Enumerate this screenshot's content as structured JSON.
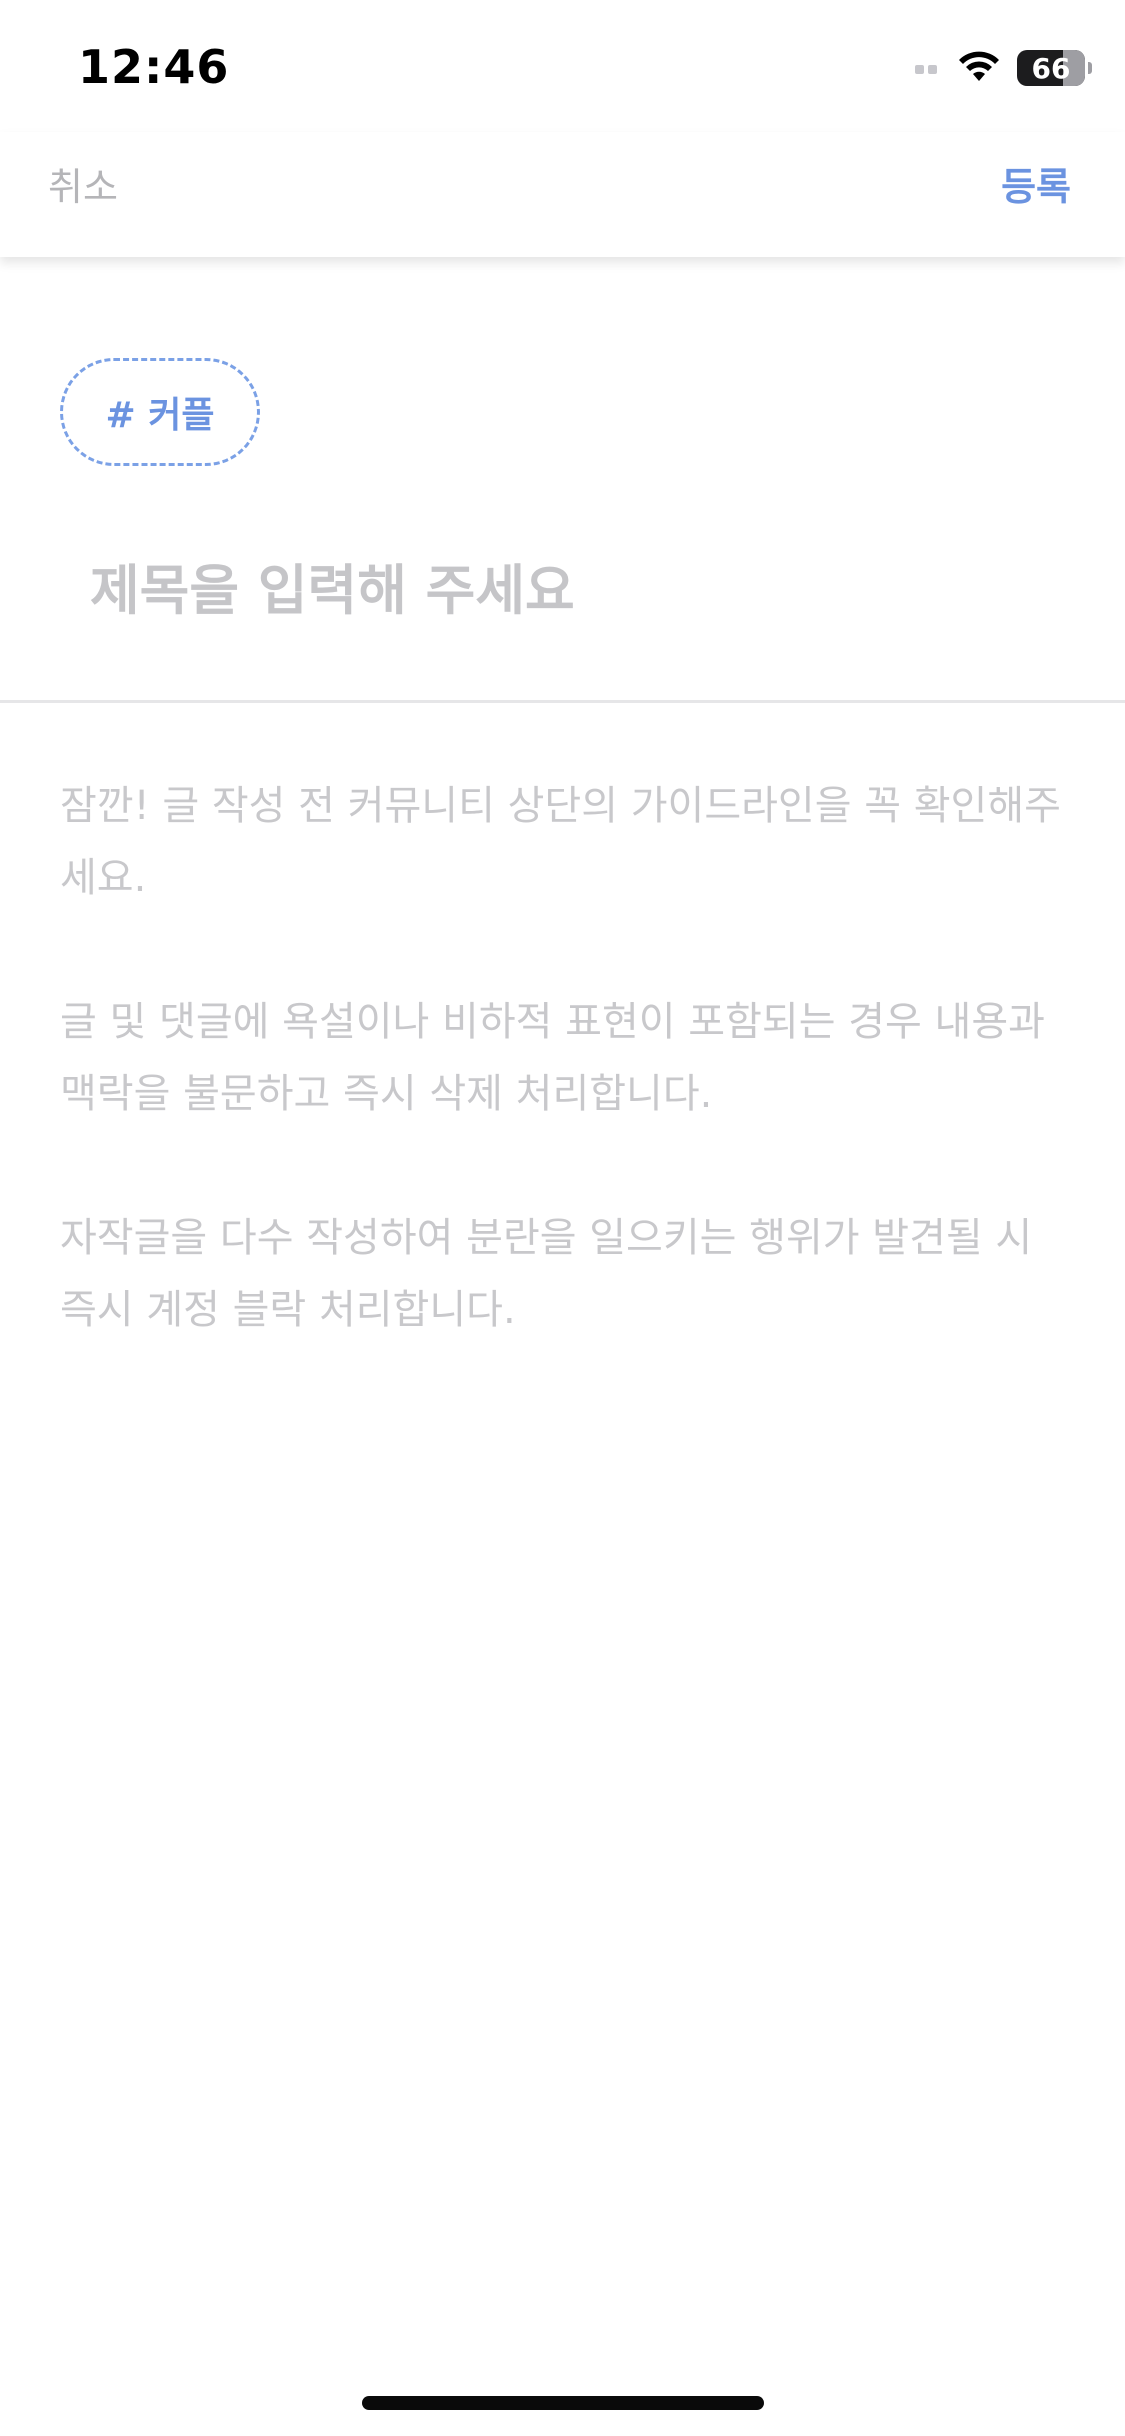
{
  "status_bar": {
    "time": "12:46",
    "battery": "66"
  },
  "nav": {
    "cancel_label": "취소",
    "submit_label": "등록"
  },
  "tag": {
    "label": "# 커플"
  },
  "title_field": {
    "placeholder": "제목을 입력해 주세요",
    "value": ""
  },
  "body": {
    "paragraphs": [
      "잠깐! 글 작성 전 커뮤니티 상단의 가이드라인을 꼭 확인해주세요.",
      "글 및 댓글에 욕설이나 비하적 표현이 포함되는 경우 내용과 맥락을 불문하고 즉시 삭제 처리합니다.",
      "자작글을 다수 작성하여 분란을 일으키는 행위가 발견될 시 즉시 계정 블락 처리합니다."
    ]
  },
  "colors": {
    "accent": "#6b93e0",
    "muted_text": "#c8c8cb",
    "cancel_text": "#b5b5b8"
  }
}
